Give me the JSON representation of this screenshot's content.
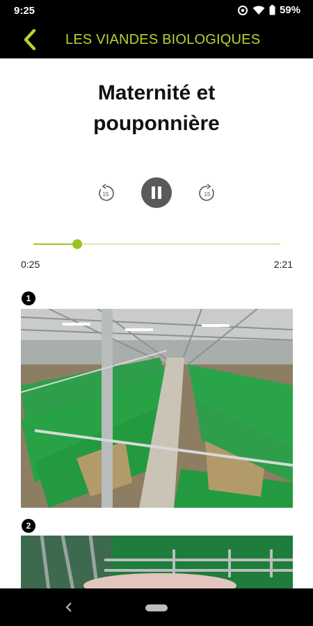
{
  "status_bar": {
    "time": "9:25",
    "battery": "59%"
  },
  "app_bar": {
    "title": "LES VIANDES BIOLOGIQUES"
  },
  "player": {
    "title": "Maternité et pouponnière",
    "skip_back_seconds": "15",
    "skip_forward_seconds": "15",
    "current_time": "0:25",
    "total_time": "2:21",
    "progress_fraction": 0.177,
    "state": "playing"
  },
  "sections": [
    {
      "number": "1",
      "image": "barn-overview-photo"
    },
    {
      "number": "2",
      "image": "sow-pen-photo"
    }
  ],
  "colors": {
    "accent": "#b8d430",
    "progress": "#9bc21f",
    "pause_button": "#5a5a5a"
  }
}
